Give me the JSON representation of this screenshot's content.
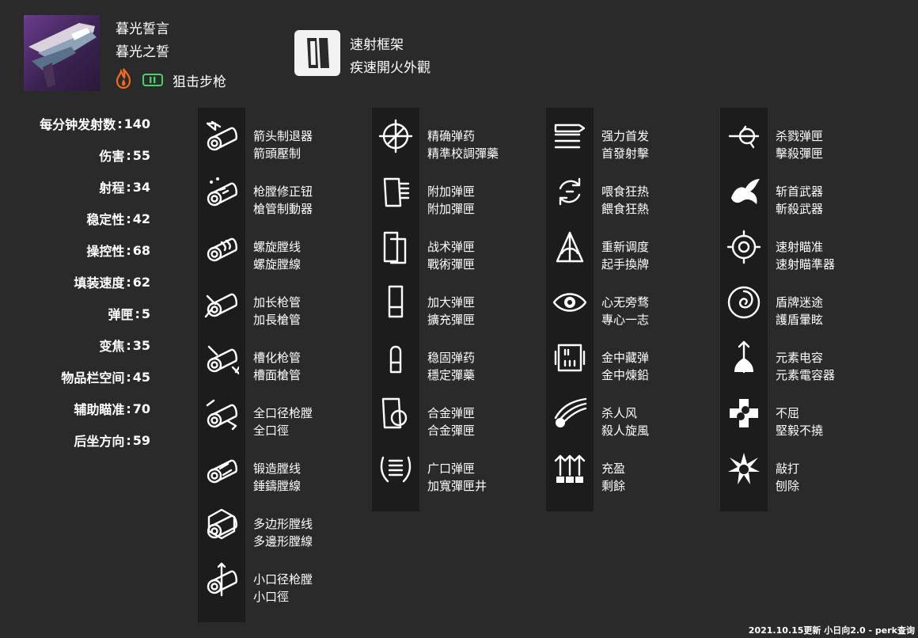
{
  "weapon": {
    "name_cn": "暮光誓言",
    "name_tw": "暮光之誓",
    "type": "狙击步枪",
    "element_icon": "solar-flame-icon",
    "ammo_icon": "special-ammo-icon",
    "element_color": "#f26b1d",
    "ammo_color": "#44d36a"
  },
  "frame": {
    "name_cn": "速射框架",
    "name_tw": "疾速開火外觀",
    "icon": "rapid-fire-frame-icon"
  },
  "stats": [
    {
      "label": "每分钟发射数",
      "value": "140"
    },
    {
      "label": "伤害",
      "value": "55"
    },
    {
      "label": "射程",
      "value": "34"
    },
    {
      "label": "稳定性",
      "value": "42"
    },
    {
      "label": "操控性",
      "value": "68"
    },
    {
      "label": "填装速度",
      "value": "62"
    },
    {
      "label": "弹匣",
      "value": "5"
    },
    {
      "label": "变焦",
      "value": "35"
    },
    {
      "label": "物品栏空间",
      "value": "45"
    },
    {
      "label": "辅助瞄准",
      "value": "70"
    },
    {
      "label": "后坐方向",
      "value": "59"
    }
  ],
  "stat_separator": ":",
  "perk_columns": [
    {
      "items": [
        {
          "cn": "箭头制退器",
          "tw": "箭頭壓制",
          "icon": "arrowhead-brake-icon"
        },
        {
          "cn": "枪膛修正钮",
          "tw": "槍管制動器",
          "icon": "corkscrew-rifling-icon"
        },
        {
          "cn": "螺旋膛线",
          "tw": "螺旋膛線",
          "icon": "spiral-rifling-icon"
        },
        {
          "cn": "加长枪管",
          "tw": "加長槍管",
          "icon": "extended-barrel-icon"
        },
        {
          "cn": "槽化枪管",
          "tw": "槽面槍管",
          "icon": "fluted-barrel-icon"
        },
        {
          "cn": "全口径枪膛",
          "tw": "全口徑",
          "icon": "full-bore-icon"
        },
        {
          "cn": "锻造膛线",
          "tw": "錘鑄膛線",
          "icon": "hammer-forged-rifling-icon"
        },
        {
          "cn": "多边形膛线",
          "tw": "多邊形膛線",
          "icon": "polygonal-rifling-icon"
        },
        {
          "cn": "小口径枪膛",
          "tw": "小口徑",
          "icon": "smallbore-icon"
        }
      ]
    },
    {
      "items": [
        {
          "cn": "精确弹药",
          "tw": "精準校調彈藥",
          "icon": "accurized-rounds-icon"
        },
        {
          "cn": "附加弹匣",
          "tw": "附加彈匣",
          "icon": "appended-mag-icon"
        },
        {
          "cn": "战术弹匣",
          "tw": "戰術彈匣",
          "icon": "tactical-mag-icon"
        },
        {
          "cn": "加大弹匣",
          "tw": "擴充彈匣",
          "icon": "extended-mag-icon"
        },
        {
          "cn": "稳固弹药",
          "tw": "穩定彈藥",
          "icon": "steady-rounds-icon"
        },
        {
          "cn": "合金弹匣",
          "tw": "合金彈匣",
          "icon": "alloy-mag-icon"
        },
        {
          "cn": "广口弹匣",
          "tw": "加寬彈匣井",
          "icon": "flared-magwell-icon"
        }
      ]
    },
    {
      "items": [
        {
          "cn": "强力首发",
          "tw": "首發射擊",
          "icon": "firmly-planted-icon"
        },
        {
          "cn": "喂食狂热",
          "tw": "餵食狂熱",
          "icon": "feeding-frenzy-icon"
        },
        {
          "cn": "重新调度",
          "tw": "起手換牌",
          "icon": "triple-tap-icon"
        },
        {
          "cn": "心无旁骛",
          "tw": "專心一志",
          "icon": "eye-icon"
        },
        {
          "cn": "金中藏弹",
          "tw": "金中煉鉛",
          "icon": "ammo-box-icon"
        },
        {
          "cn": "杀人风",
          "tw": "殺人旋風",
          "icon": "winged-skull-icon"
        },
        {
          "cn": "充盈",
          "tw": "剩餘",
          "icon": "surplus-icon"
        }
      ]
    },
    {
      "items": [
        {
          "cn": "杀戮弹匣",
          "tw": "擊殺彈匣",
          "icon": "kill-clip-icon"
        },
        {
          "cn": "斩首武器",
          "tw": "斬殺武器",
          "icon": "dragon-icon"
        },
        {
          "cn": "速射瞄准",
          "tw": "速射瞄準器",
          "icon": "snapshot-sights-icon"
        },
        {
          "cn": "盾牌迷途",
          "tw": "護盾暈眩",
          "icon": "vortex-icon"
        },
        {
          "cn": "元素电容",
          "tw": "元素電容器",
          "icon": "elemental-capacitor-icon"
        },
        {
          "cn": "不屈",
          "tw": "堅毅不撓",
          "icon": "unrelenting-icon"
        },
        {
          "cn": "敲打",
          "tw": "刨除",
          "icon": "skull-star-icon"
        }
      ]
    }
  ],
  "footer": "2021.10.15更新 小日向2.0 - perk查询"
}
